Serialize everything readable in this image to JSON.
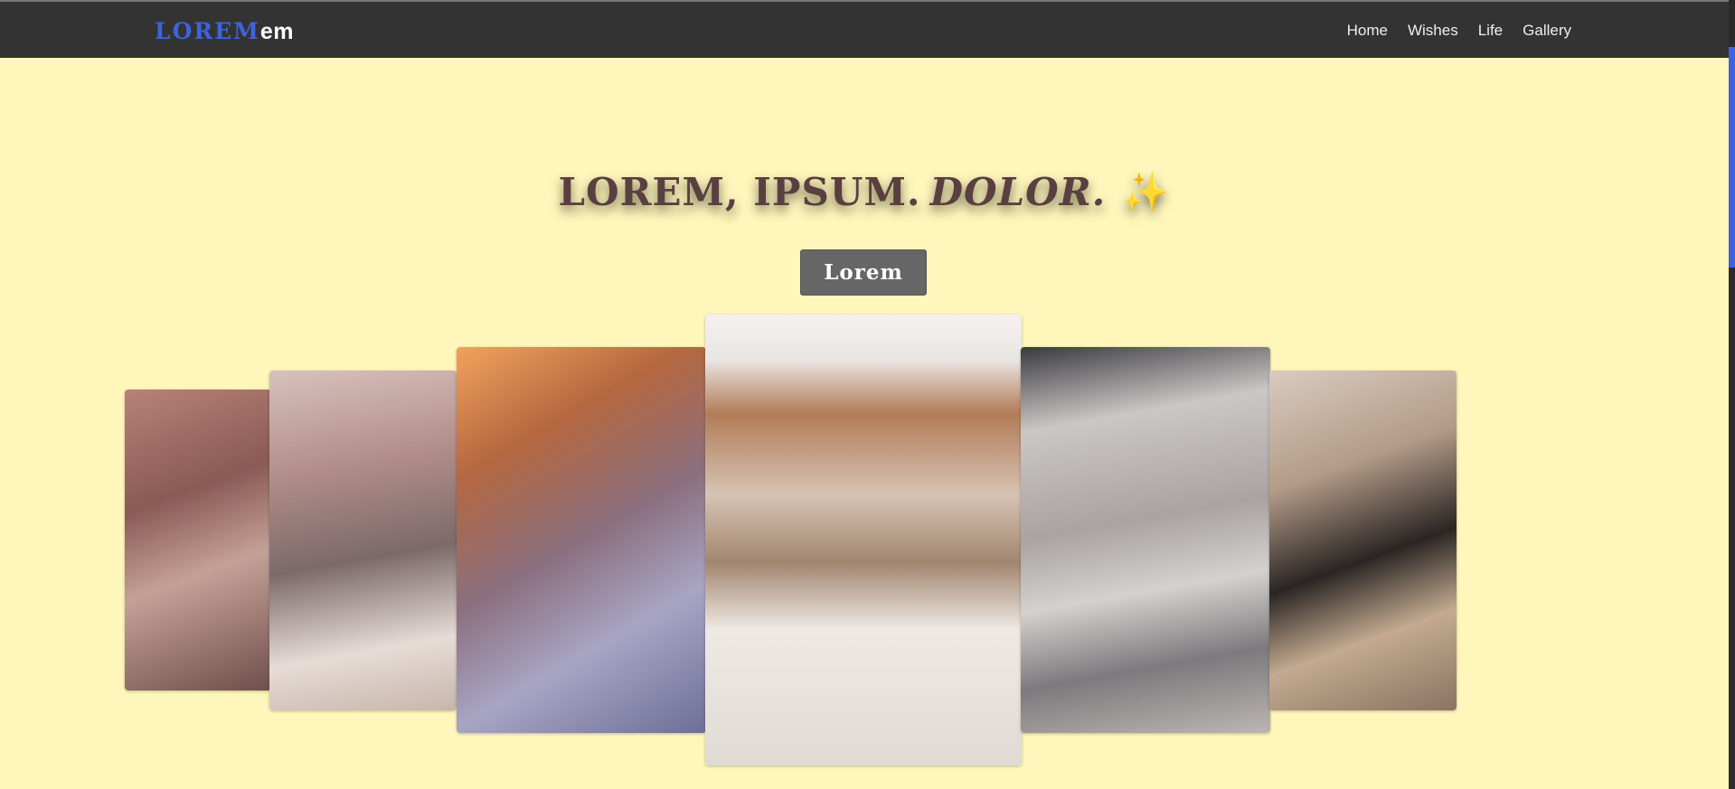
{
  "navbar": {
    "brand_part1": "LOREM",
    "brand_part2": "em",
    "links": [
      "Home",
      "Wishes",
      "Life",
      "Gallery"
    ]
  },
  "hero": {
    "title_main": "LOREM, IPSUM.",
    "title_italic": "DOLOR.",
    "title_emoji": "✨",
    "button_label": "Lorem"
  },
  "colors": {
    "page_background": "#fff6bb",
    "navbar_background": "#333333",
    "brand_accent": "#3d63dd",
    "button_background": "#666666"
  },
  "gallery": {
    "photos": [
      {
        "icon": "photo-bedroom-wall-laptop"
      },
      {
        "icon": "photo-laptop-planner"
      },
      {
        "icon": "photo-desk-pens-laptop"
      },
      {
        "icon": "photo-cafe-open-book"
      },
      {
        "icon": "photo-highlighted-notes"
      },
      {
        "icon": "photo-woman-studying"
      }
    ]
  }
}
